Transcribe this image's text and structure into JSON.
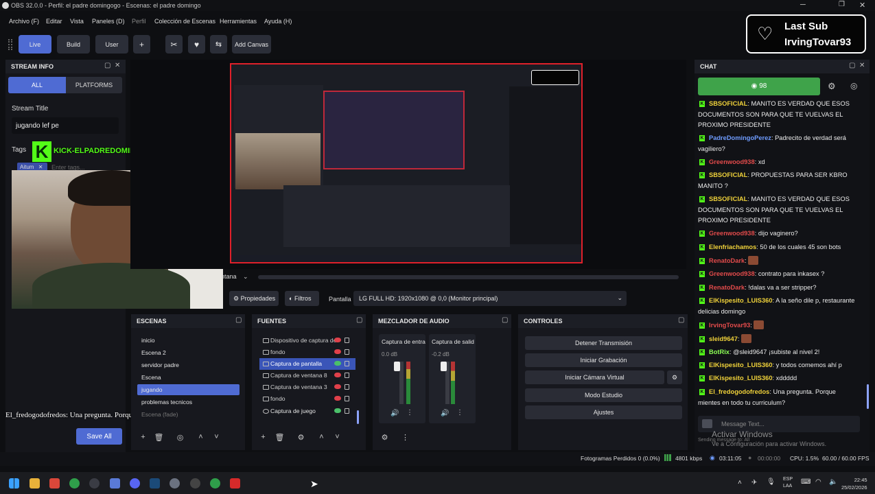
{
  "window": {
    "title": "OBS 32.0.0 - Perfil: el padre domingogo - Escenas: el padre domingo"
  },
  "menu": [
    "Archivo (F)",
    "Editar",
    "Vista",
    "Paneles (D)",
    "Perfil",
    "Colección de Escenas",
    "Herramientas",
    "Ayuda (H)"
  ],
  "toolbar": {
    "live": "Live",
    "build": "Build",
    "user": "User",
    "plus": "+",
    "add_canvas": "Add Canvas"
  },
  "last_sub": {
    "line1": "Last Sub",
    "line2": "IrvingTovar93"
  },
  "stream_info": {
    "title": "STREAM INFO",
    "tab_all": "ALL",
    "tab_platforms": "PLATFORMS",
    "stream_title_label": "Stream Title",
    "stream_title_value": "jugando lef pe",
    "tags_label": "Tags",
    "tag_chip": "Aitum",
    "tag_placeholder": "Enter tags...",
    "overlay_kick": "KICK-ELPADREDOMINGOOFICIALL",
    "save_all": "Save All"
  },
  "overlay_caption": "El_fredogodofredos: Una pregunta. Porque mientes en todo tu curriculum",
  "preview_bar": {
    "clip_left": "ntana",
    "properties": "Propiedades",
    "filters": "Filtros",
    "screen_label": "Pantalla",
    "screen_value": "LG FULL HD: 1920x1080 @ 0,0 (Monitor principal)"
  },
  "scenes": {
    "title": "ESCENAS",
    "items": [
      "inicio",
      "Escena 2",
      "servidor padre",
      "Escena",
      "jugando",
      "problemas tecnicos",
      "Escena (fade)"
    ],
    "selected": "jugando"
  },
  "sources": {
    "title": "FUENTES",
    "items": [
      {
        "label": "Dispositivo de captura de",
        "visible": false
      },
      {
        "label": "fondo",
        "visible": false
      },
      {
        "label": "Captura de pantalla",
        "visible": true
      },
      {
        "label": "Captura de ventana 8",
        "visible": false
      },
      {
        "label": "Captura de ventana 3",
        "visible": false
      },
      {
        "label": "fondo",
        "visible": false
      },
      {
        "label": "Captura de juego",
        "visible": true
      }
    ],
    "selected_index": 2
  },
  "mixer": {
    "title": "MEZCLADOR DE AUDIO",
    "channels": [
      {
        "name": "Captura de entra",
        "db": "0.0 dB"
      },
      {
        "name": "Captura de salid",
        "db": "-0.2 dB"
      }
    ]
  },
  "controls": {
    "title": "CONTROLES",
    "buttons": [
      "Detener Transmisión",
      "Iniciar Grabación",
      "Iniciar Cámara Virtual",
      "Modo Estudio",
      "Ajustes"
    ]
  },
  "chat": {
    "title": "CHAT",
    "viewers": "98",
    "messages": [
      {
        "user": "SBSOFICIAL",
        "color": "#f0d23a",
        "text": ": MANITO ES VERDAD QUE ESOS DOCUMENTOS SON PARA QUE TE VUELVAS EL PROXIMO PRESIDENTE"
      },
      {
        "user": "PadreDomingoPerez",
        "color": "#6f9cff",
        "text": ": Padrecito de verdad será vagiliero?"
      },
      {
        "user": "Greenwood938",
        "color": "#e34b4b",
        "text": ": xd"
      },
      {
        "user": "SBSOFICIAL",
        "color": "#f0d23a",
        "text": ": PROPUESTAS PARA SER KBRO MANITO ?"
      },
      {
        "user": "SBSOFICIAL",
        "color": "#f0d23a",
        "text": ": MANITO ES VERDAD QUE ESOS DOCUMENTOS SON PARA QUE TE VUELVAS EL PROXIMO PRESIDENTE"
      },
      {
        "user": "Greenwood938",
        "color": "#e34b4b",
        "text": ": dijo vaginero?"
      },
      {
        "user": "Elenfriachamos",
        "color": "#f0d23a",
        "text": ": 50 de los cuales 45 son bots"
      },
      {
        "user": "RenatoDark",
        "color": "#e34b4b",
        "text": ":"
      },
      {
        "user": "Greenwood938",
        "color": "#e34b4b",
        "text": ": contrato para inkasex ?"
      },
      {
        "user": "RenatoDark",
        "color": "#e34b4b",
        "text": ": !dalas va a ser stripper?"
      },
      {
        "user": "ElKispesito_LUIS360",
        "color": "#f0d23a",
        "text": ": A la seño dile p, restaurante delicias domingo"
      },
      {
        "user": "IrvingTovar93",
        "color": "#e34b4b",
        "text": ":"
      },
      {
        "user": "sleid9647",
        "color": "#f0d23a",
        "text": ":"
      },
      {
        "user": "BotRix",
        "color": "#8cff55",
        "text": ": @sleid9647 ¡subiste al nivel 2!"
      },
      {
        "user": "ElKispesito_LUIS360",
        "color": "#f0d23a",
        "text": ": y todos comemos ahí p"
      },
      {
        "user": "ElKispesito_LUIS360",
        "color": "#f0d23a",
        "text": ": xddddd"
      },
      {
        "user": "El_fredogodofredos",
        "color": "#f0d23a",
        "text": ": Una pregunta. Porque mientes en todo tu curriculum?"
      }
    ],
    "input_placeholder": "Message Text...",
    "sending_hint": "Sending message to: All",
    "activate_title": "Activar Windows",
    "activate_sub": "Ve a Configuración para activar Windows."
  },
  "statusbar": {
    "dropped": "Fotogramas Perdidos 0 (0.0%)",
    "bitrate": "4801 kbps",
    "live_time": "03:11:05",
    "rec_time": "00:00:00",
    "cpu": "CPU: 1.5%",
    "fps": "60.00 / 60.00 FPS"
  },
  "taskbar": {
    "lang1": "ESP",
    "lang2": "LAA",
    "time": "22:45",
    "date": "25/02/2026"
  }
}
